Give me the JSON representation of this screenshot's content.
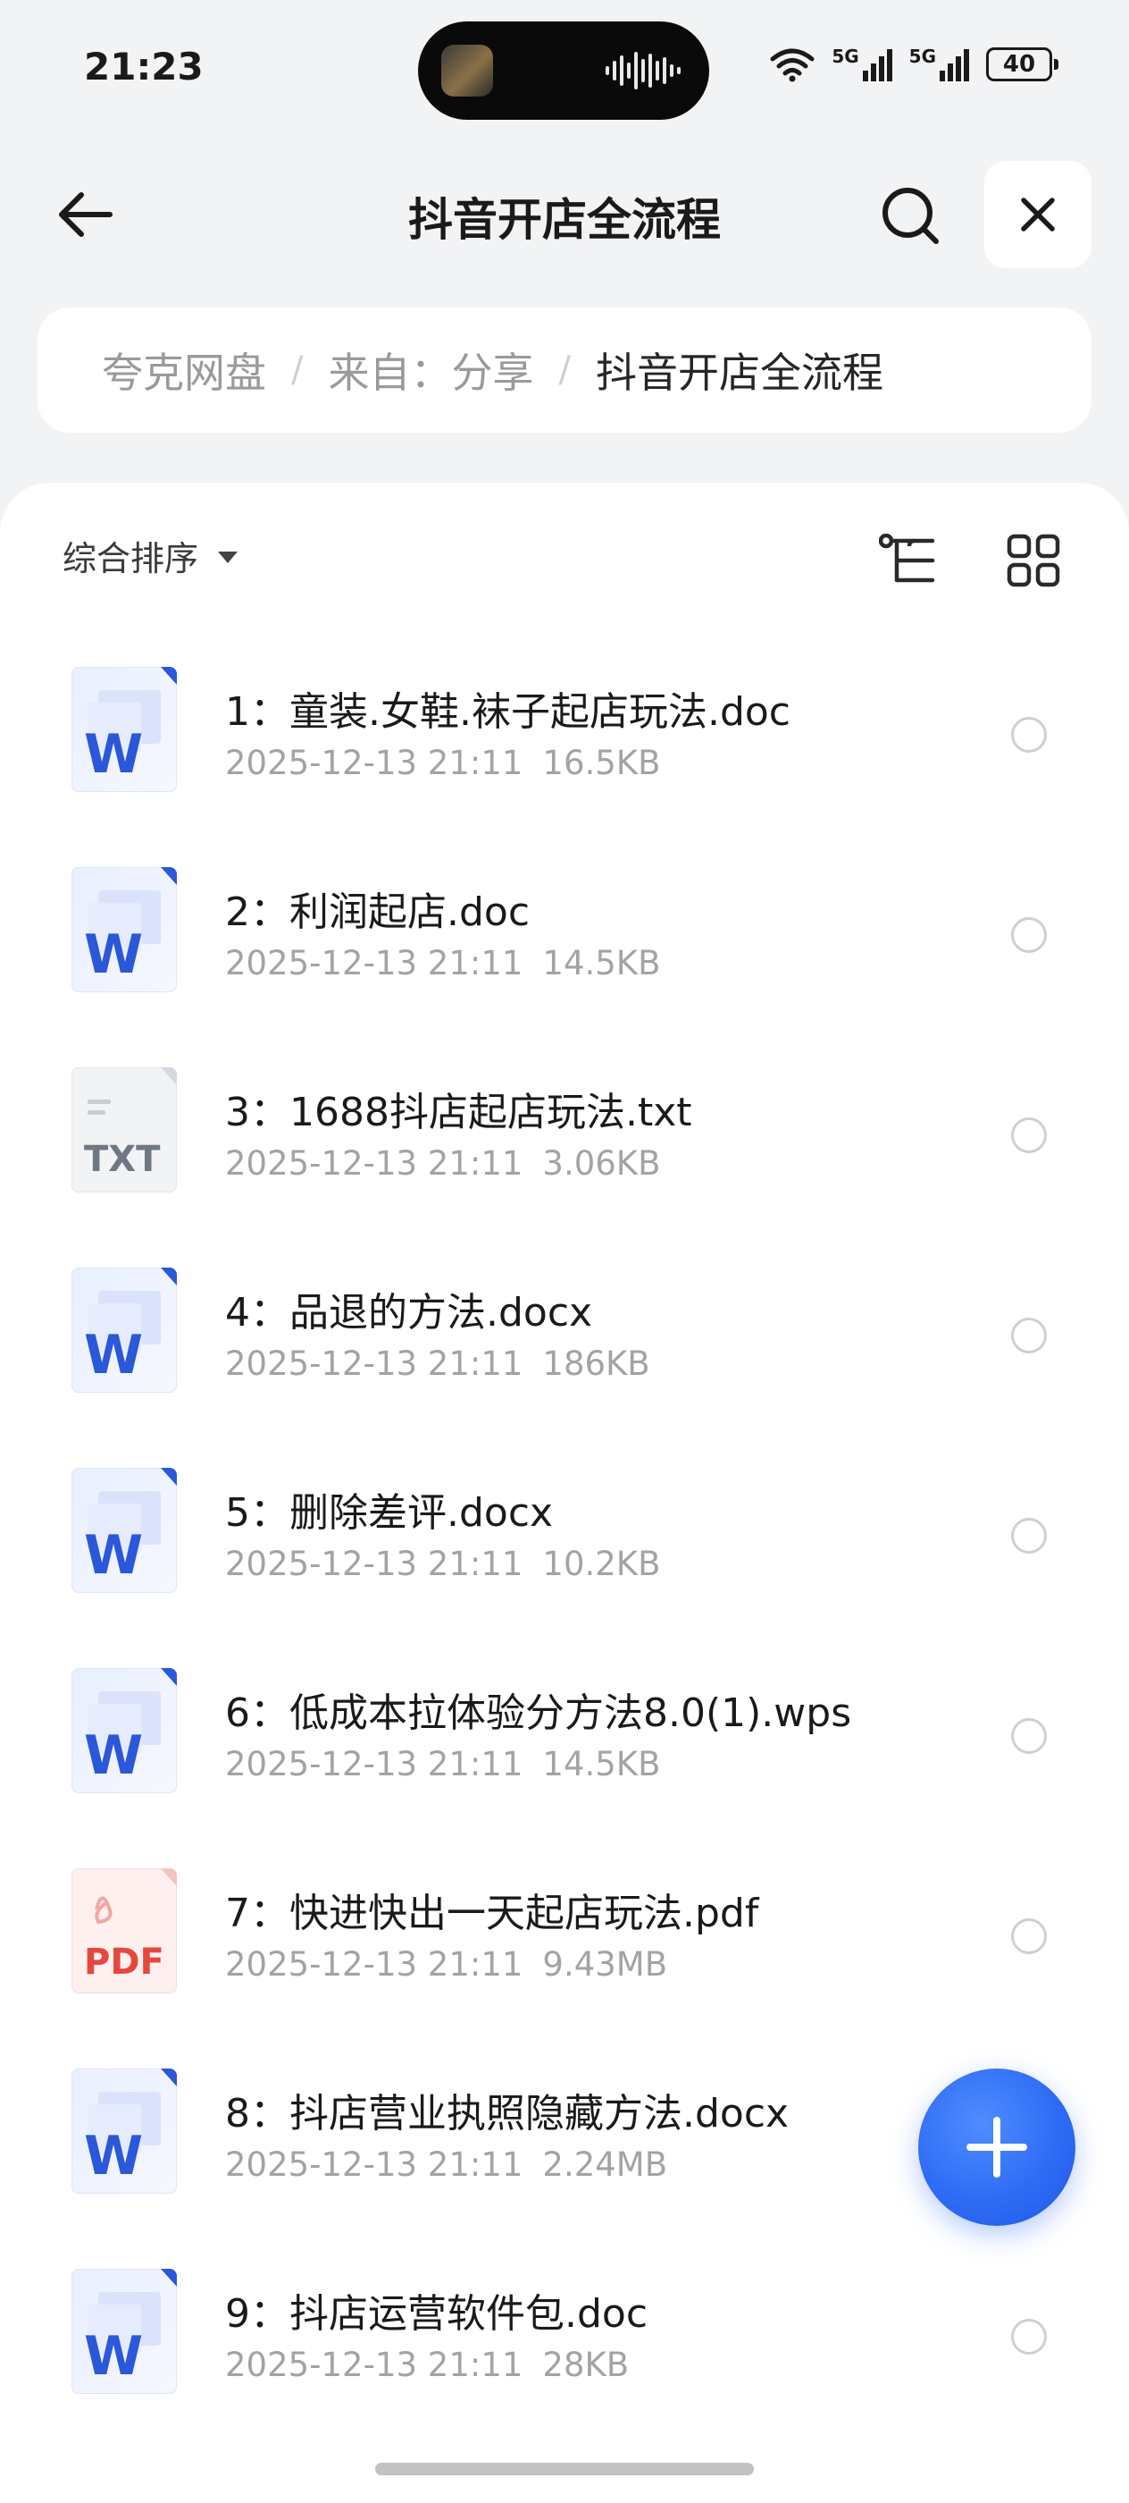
{
  "status_bar": {
    "time": "21:23",
    "network_1": "5G",
    "network_2": "5G",
    "battery": "40"
  },
  "header": {
    "title": "抖音开店全流程"
  },
  "breadcrumb": [
    {
      "label": "夸克网盘"
    },
    {
      "label": "来自：分享"
    },
    {
      "label": "抖音开店全流程"
    }
  ],
  "toolbar": {
    "sort_label": "综合排序"
  },
  "files": [
    {
      "name": "1：童装.女鞋.袜子起店玩法.doc",
      "date": "2025-12-13 21:11",
      "size": "16.5KB",
      "type": "word",
      "badge": "W"
    },
    {
      "name": "2：利润起店.doc",
      "date": "2025-12-13 21:11",
      "size": "14.5KB",
      "type": "word",
      "badge": "W"
    },
    {
      "name": "3：1688抖店起店玩法.txt",
      "date": "2025-12-13 21:11",
      "size": "3.06KB",
      "type": "txt",
      "badge": "TXT"
    },
    {
      "name": "4：品退的方法.docx",
      "date": "2025-12-13 21:11",
      "size": "186KB",
      "type": "word",
      "badge": "W"
    },
    {
      "name": "5：删除差评.docx",
      "date": "2025-12-13 21:11",
      "size": "10.2KB",
      "type": "word",
      "badge": "W"
    },
    {
      "name": "6：低成本拉体验分方法8.0(1).wps",
      "date": "2025-12-13 21:11",
      "size": "14.5KB",
      "type": "word",
      "badge": "W"
    },
    {
      "name": "7：快进快出一天起店玩法.pdf",
      "date": "2025-12-13 21:11",
      "size": "9.43MB",
      "type": "pdf",
      "badge": "PDF"
    },
    {
      "name": "8：抖店营业执照隐藏方法.docx",
      "date": "2025-12-13 21:11",
      "size": "2.24MB",
      "type": "word",
      "badge": "W"
    },
    {
      "name": "9：抖店运营软件包.doc",
      "date": "2025-12-13 21:11",
      "size": "28KB",
      "type": "word",
      "badge": "W"
    }
  ],
  "colors": {
    "accent": "#2f6cf5",
    "word_blue": "#2b57d9",
    "pdf_red": "#e5483f",
    "txt_gray": "#6f7785"
  },
  "icons": {
    "back": "arrow-left-icon",
    "search": "search-icon",
    "close": "close-icon",
    "tree": "tree-view-icon",
    "grid": "grid-view-icon",
    "add": "plus-icon"
  }
}
